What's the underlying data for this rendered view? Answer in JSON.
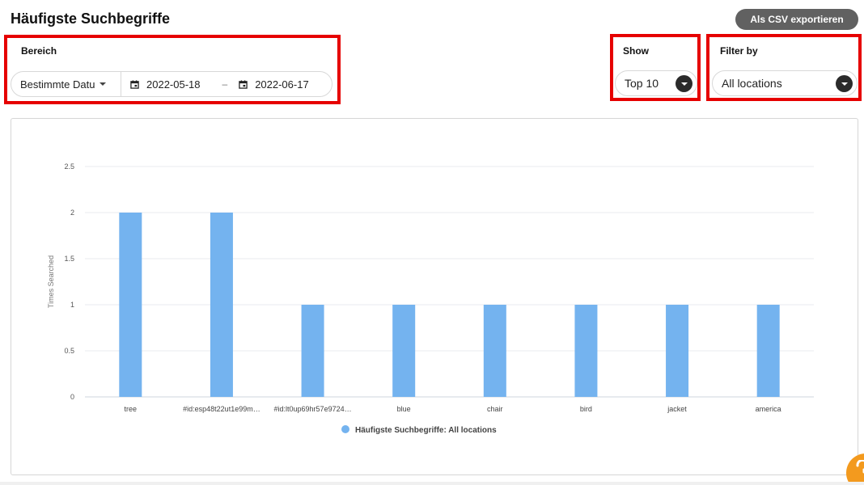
{
  "header": {
    "title": "Häufigste Suchbegriffe",
    "export_label": "Als CSV exportieren"
  },
  "range": {
    "label": "Bereich",
    "mode": "Bestimmte Datu",
    "start_date": "2022-05-18",
    "separator": "–",
    "end_date": "2022-06-17"
  },
  "show": {
    "label": "Show",
    "value": "Top 10"
  },
  "filter": {
    "label": "Filter by",
    "value": "All locations"
  },
  "colors": {
    "bar": "#74b3ef",
    "highlight": "#e60000",
    "export_button": "#616161",
    "help_fab": "#f39a1e"
  },
  "icons": [
    "calendar-icon",
    "caret-down-icon",
    "chevron-down-icon",
    "help-icon"
  ],
  "chart_data": {
    "type": "bar",
    "categories": [
      "tree",
      "#id:esp48t22ut1e99m…",
      "#id:lt0up69hr57e9724…",
      "blue",
      "chair",
      "bird",
      "jacket",
      "america"
    ],
    "series": [
      {
        "name": "Häufigste Suchbegriffe: All locations",
        "values": [
          2,
          2,
          1,
          1,
          1,
          1,
          1,
          1
        ]
      }
    ],
    "ylabel": "Times Searched",
    "xlabel": "",
    "ylim": [
      0,
      2.5
    ],
    "yticks": [
      "0",
      "0.5",
      "1",
      "1.5",
      "2",
      "2.5"
    ],
    "grid": true,
    "legend": "bottom-center"
  }
}
